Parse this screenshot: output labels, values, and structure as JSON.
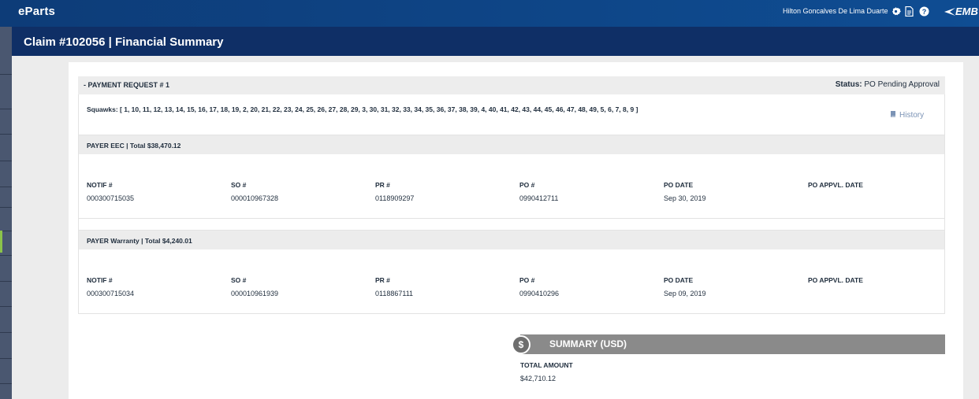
{
  "app": {
    "brand": "eParts",
    "user_name": "Hilton Goncalves De Lima Duarte",
    "logo_text": "EMB"
  },
  "icons": {
    "settings": "gear-icon",
    "document": "document-icon",
    "help": "help-icon",
    "history": "book-icon",
    "summary": "dollar-icon"
  },
  "page": {
    "title": "Claim #102056 | Financial Summary"
  },
  "payment_request": {
    "title": "- PAYMENT REQUEST # 1",
    "status_label": "Status:",
    "status_value": "PO Pending Approval",
    "squawks": "Squawks: [ 1, 10, 11, 12, 13, 14, 15, 16, 17, 18, 19, 2, 20, 21, 22, 23, 24, 25, 26, 27, 28, 29, 3, 30, 31, 32, 33, 34, 35, 36, 37, 38, 39, 4, 40, 41, 42, 43, 44, 45, 46, 47, 48, 49, 5, 6, 7, 8, 9 ]",
    "history_label": "History"
  },
  "columns": [
    "NOTIF #",
    "SO #",
    "PR #",
    "PO #",
    "PO DATE",
    "PO APPVL. DATE"
  ],
  "payers": [
    {
      "title": "PAYER EEC | Total $38,470.12",
      "values": [
        "000300715035",
        "000010967328",
        "0118909297",
        "0990412711",
        "Sep 30, 2019",
        ""
      ]
    },
    {
      "title": "PAYER Warranty | Total $4,240.01",
      "values": [
        "000300715034",
        "000010961939",
        "0118867111",
        "0990410296",
        "Sep 09, 2019",
        ""
      ]
    }
  ],
  "summary": {
    "dollar_glyph": "$",
    "title": "SUMMARY (USD)",
    "total_label": "TOTAL AMOUNT",
    "total_value": "$42,710.12"
  },
  "colors": {
    "topbar": "#0f4d93",
    "titlebar": "#0f2f66",
    "summary": "#8a8a8a",
    "history_link": "#7b93b5"
  }
}
